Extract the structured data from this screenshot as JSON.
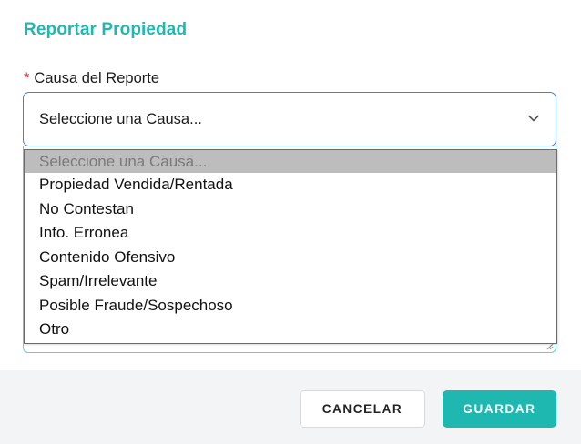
{
  "modal": {
    "title": "Reportar Propiedad"
  },
  "field": {
    "required_marker": "*",
    "label": "Causa del Reporte",
    "selected_value": "Seleccione una Causa...",
    "chevron_icon": "chevron-down-icon"
  },
  "dropdown": {
    "options": [
      "Seleccione una Causa...",
      "Propiedad Vendida/Rentada",
      "No Contestan",
      "Info. Erronea",
      "Contenido Ofensivo",
      "Spam/Irrelevante",
      "Posible Fraude/Sospechoso",
      "Otro"
    ]
  },
  "footer": {
    "cancel_label": "CANCELAR",
    "save_label": "GUARDAR"
  },
  "colors": {
    "accent": "#1fb8b0",
    "required": "#e0283d",
    "focus_border": "#4a7fd8"
  }
}
